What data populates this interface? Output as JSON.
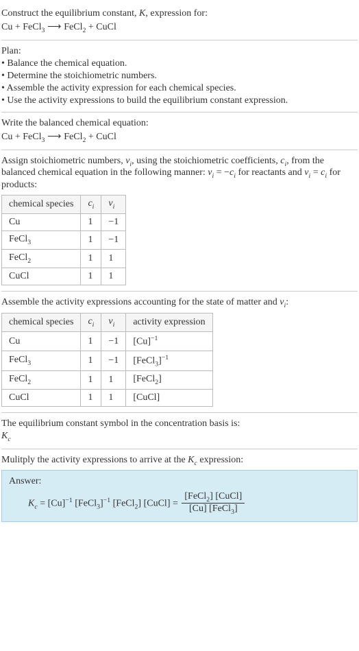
{
  "intro": {
    "line1_pre": "Construct the equilibrium constant, ",
    "line1_K": "K",
    "line1_post": ", expression for:",
    "eq_lhs1": "Cu + FeCl",
    "eq_lhs1_sub": "3",
    "eq_arrow": " ⟶ ",
    "eq_rhs1": "FeCl",
    "eq_rhs1_sub": "2",
    "eq_rhs2": " + CuCl"
  },
  "plan": {
    "title": "Plan:",
    "b1": "• Balance the chemical equation.",
    "b2": "• Determine the stoichiometric numbers.",
    "b3": "• Assemble the activity expression for each chemical species.",
    "b4": "• Use the activity expressions to build the equilibrium constant expression."
  },
  "balanced": {
    "title": "Write the balanced chemical equation:"
  },
  "assign": {
    "p1": "Assign stoichiometric numbers, ",
    "nu": "ν",
    "i": "i",
    "p2": ", using the stoichiometric coefficients, ",
    "c": "c",
    "p3": ", from the balanced chemical equation in the following manner: ",
    "rel1a": "ν",
    "rel1b": " = −",
    "rel1c": "c",
    "p4": " for reactants and ",
    "rel2a": "ν",
    "rel2b": " = ",
    "rel2c": "c",
    "p5": " for products:",
    "h1": "chemical species",
    "h2": "c",
    "h3": "ν",
    "r1s": "Cu",
    "r1c": "1",
    "r1n": "−1",
    "r2s": "FeCl",
    "r2sub": "3",
    "r2c": "1",
    "r2n": "−1",
    "r3s": "FeCl",
    "r3sub": "2",
    "r3c": "1",
    "r3n": "1",
    "r4s": "CuCl",
    "r4c": "1",
    "r4n": "1"
  },
  "activity": {
    "title_pre": "Assemble the activity expressions accounting for the state of matter and ",
    "title_nu": "ν",
    "title_i": "i",
    "title_post": ":",
    "h1": "chemical species",
    "h2": "c",
    "h3": "ν",
    "h4": "activity expression",
    "r1s": "Cu",
    "r1c": "1",
    "r1n": "−1",
    "r1a_pre": "[Cu]",
    "r1a_sup": "−1",
    "r2s": "FeCl",
    "r2sub": "3",
    "r2c": "1",
    "r2n": "−1",
    "r2a_pre": "[FeCl",
    "r2a_sub": "3",
    "r2a_mid": "]",
    "r2a_sup": "−1",
    "r3s": "FeCl",
    "r3sub": "2",
    "r3c": "1",
    "r3n": "1",
    "r3a_pre": "[FeCl",
    "r3a_sub": "2",
    "r3a_post": "]",
    "r4s": "CuCl",
    "r4c": "1",
    "r4n": "1",
    "r4a": "[CuCl]"
  },
  "symbol": {
    "line": "The equilibrium constant symbol in the concentration basis is:",
    "K": "K",
    "c": "c"
  },
  "multiply": {
    "line_pre": "Mulitply the activity expressions to arrive at the ",
    "K": "K",
    "c": "c",
    "line_post": " expression:"
  },
  "answer": {
    "label": "Answer:",
    "lhs_K": "K",
    "lhs_c": "c",
    "eq": " = ",
    "t1": "[Cu]",
    "t1sup": "−1",
    "t2a": " [FeCl",
    "t2sub": "3",
    "t2b": "]",
    "t2sup": "−1",
    "t3a": " [FeCl",
    "t3sub": "2",
    "t3b": "]",
    "t4": " [CuCl]",
    "eq2": " = ",
    "num1a": "[FeCl",
    "num1sub": "2",
    "num1b": "]",
    "num2": " [CuCl]",
    "den1": "[Cu]",
    "den2a": " [FeCl",
    "den2sub": "3",
    "den2b": "]"
  }
}
